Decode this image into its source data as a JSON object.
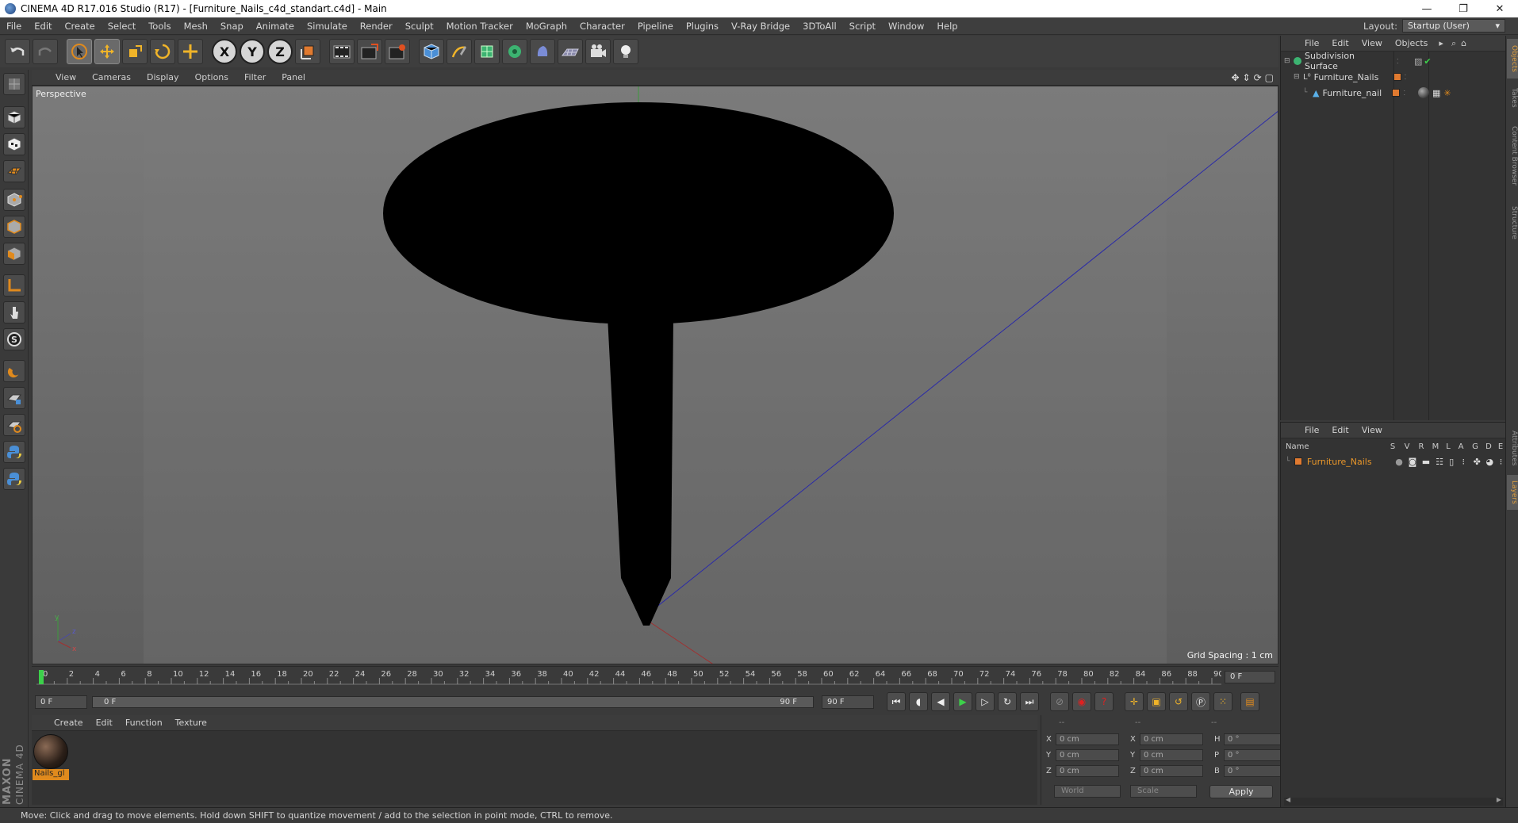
{
  "window": {
    "title": "CINEMA 4D R17.016 Studio (R17) - [Furniture_Nails_c4d_standart.c4d] - Main",
    "minimize": "—",
    "restore": "❐",
    "close": "✕"
  },
  "menubar": {
    "items": [
      "File",
      "Edit",
      "Create",
      "Select",
      "Tools",
      "Mesh",
      "Snap",
      "Animate",
      "Simulate",
      "Render",
      "Sculpt",
      "Motion Tracker",
      "MoGraph",
      "Character",
      "Pipeline",
      "Plugins",
      "V-Ray Bridge",
      "3DToAll",
      "Script",
      "Window",
      "Help"
    ],
    "layout_label": "Layout:",
    "layout_value": "Startup (User)"
  },
  "toolbar": {
    "axis_labels": [
      "X",
      "Y",
      "Z"
    ]
  },
  "viewport": {
    "menu": [
      "View",
      "Cameras",
      "Display",
      "Options",
      "Filter",
      "Panel"
    ],
    "camera_label": "Perspective",
    "grid_spacing": "Grid Spacing : 1 cm",
    "axis_labels": {
      "y": "y",
      "z": "z",
      "x": "x"
    }
  },
  "timeline": {
    "ticks": [
      "0",
      "2",
      "4",
      "6",
      "8",
      "10",
      "12",
      "14",
      "16",
      "18",
      "20",
      "22",
      "24",
      "26",
      "28",
      "30",
      "32",
      "34",
      "36",
      "38",
      "40",
      "42",
      "44",
      "46",
      "48",
      "50",
      "52",
      "54",
      "56",
      "58",
      "60",
      "62",
      "64",
      "66",
      "68",
      "70",
      "72",
      "74",
      "76",
      "78",
      "80",
      "82",
      "84",
      "86",
      "88",
      "90"
    ],
    "current_frame": "0 F"
  },
  "playbar": {
    "start_field": "0 F",
    "slider_start": "0 F",
    "slider_end": "90 F",
    "end_field": "90 F"
  },
  "material_manager": {
    "menu": [
      "Create",
      "Edit",
      "Function",
      "Texture"
    ],
    "material_name": "Nails_gl"
  },
  "coordinates": {
    "headers": [
      "--",
      "--",
      "--"
    ],
    "rows": [
      {
        "l1": "X",
        "v1": "0 cm",
        "l2": "X",
        "v2": "0 cm",
        "l3": "H",
        "v3": "0 °"
      },
      {
        "l1": "Y",
        "v1": "0 cm",
        "l2": "Y",
        "v2": "0 cm",
        "l3": "P",
        "v3": "0 °"
      },
      {
        "l1": "Z",
        "v1": "0 cm",
        "l2": "Z",
        "v2": "0 cm",
        "l3": "B",
        "v3": "0 °"
      }
    ],
    "space": "World",
    "mode": "Scale",
    "apply": "Apply"
  },
  "object_manager": {
    "menu": [
      "File",
      "Edit",
      "View",
      "Objects"
    ],
    "objects": [
      {
        "name": "Subdivision Surface"
      },
      {
        "name": "Furniture_Nails"
      },
      {
        "name": "Furniture_nail"
      }
    ]
  },
  "layer_manager": {
    "menu": [
      "File",
      "Edit",
      "View"
    ],
    "columns": [
      "Name",
      "S",
      "V",
      "R",
      "M",
      "L",
      "A",
      "G",
      "D",
      "E"
    ],
    "layers": [
      {
        "name": "Furniture_Nails"
      }
    ]
  },
  "right_tabs": [
    "Objects",
    "Takes",
    "Content Browser",
    "Structure",
    "Attributes",
    "Layers"
  ],
  "status": "Move: Click and drag to move elements. Hold down SHIFT to quantize movement / add to the selection in point mode, CTRL to remove.",
  "brand": {
    "top": "MAXON",
    "bottom": "CINEMA 4D"
  },
  "colors": {
    "accent": "#e08a1d",
    "tag": "#e07a30"
  }
}
